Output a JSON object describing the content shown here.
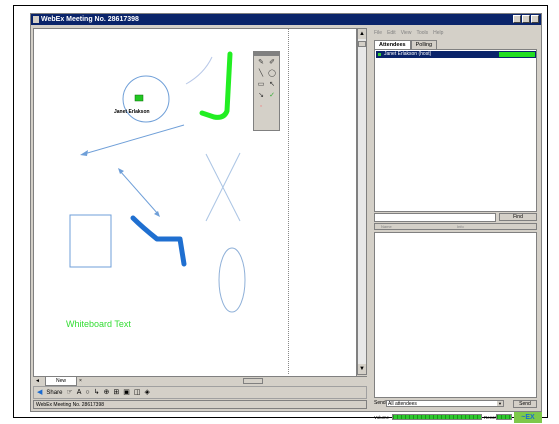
{
  "window": {
    "title": "WebEx Meeting No. 28617398"
  },
  "canvas": {
    "whiteboard_text": "Whiteboard Text",
    "presenter_name": "Janet Erlakson"
  },
  "tab": {
    "label": "New"
  },
  "toolbar": {
    "share_label": "Share",
    "icons": [
      "pointer-icon",
      "text-icon",
      "shape-icon",
      "arrow-icon",
      "zoom-icon",
      "grid-icon",
      "page-icon",
      "print-icon",
      "erase-icon"
    ]
  },
  "status": {
    "text": "WebEx Meeting No. 28617398"
  },
  "right_panel": {
    "menu": [
      "File",
      "Edit",
      "View",
      "Tools",
      "Help"
    ],
    "tabs": [
      "Attendees",
      "Polling"
    ],
    "attendee": {
      "name": "Janet Erlakson (host)"
    },
    "find_label": "Find",
    "columns": [
      "Name",
      "Info"
    ],
    "send_to_label": "Send to",
    "send_to_value": "All attendees",
    "send_label": "Send",
    "volume_label": "Volume",
    "record_label": "Record"
  },
  "colors": {
    "title_bar": "#0a246a",
    "selection": "#0a246a",
    "meter_green": "#2ec82e",
    "whiteboard_text": "#33dd33",
    "pen_blue": "#1f6fd0",
    "pen_green": "#22ee22",
    "shape_blue": "#6f9fd8"
  }
}
